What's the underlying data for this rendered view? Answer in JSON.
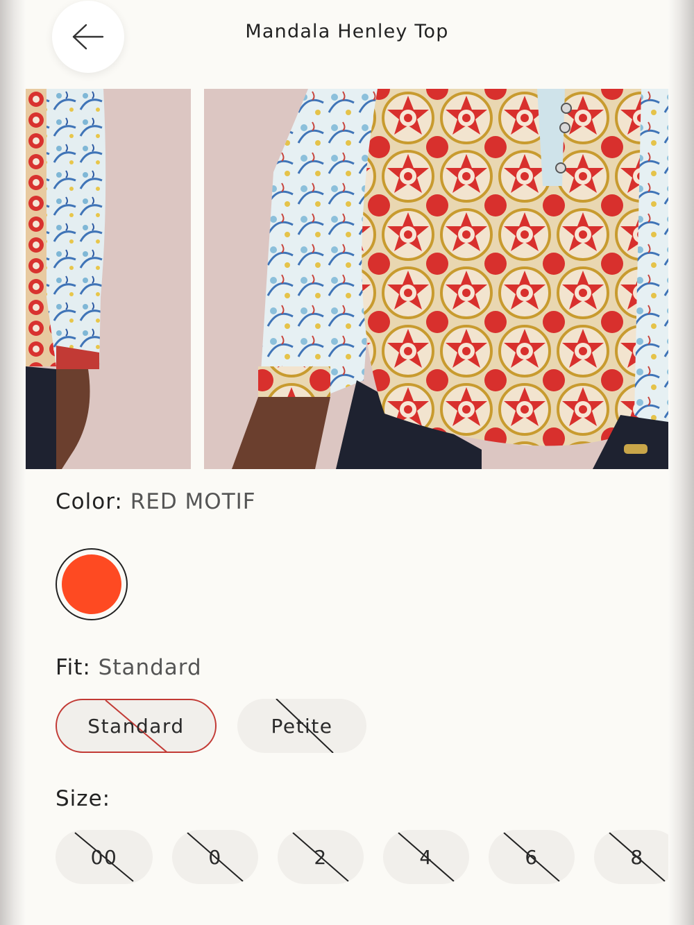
{
  "header": {
    "title": "Mandala Henley Top",
    "back_icon": "arrow-left-icon"
  },
  "color": {
    "label": "Color:",
    "value": "RED MOTIF",
    "swatch_hex": "#fe4a22"
  },
  "fit": {
    "label": "Fit:",
    "value": "Standard",
    "options": [
      {
        "label": "Standard",
        "selected": true,
        "unavailable": true
      },
      {
        "label": "Petite",
        "selected": false,
        "unavailable": true
      }
    ]
  },
  "size": {
    "label": "Size:",
    "options": [
      {
        "label": "00",
        "unavailable": true
      },
      {
        "label": "0",
        "unavailable": true
      },
      {
        "label": "2",
        "unavailable": true
      },
      {
        "label": "4",
        "unavailable": true
      },
      {
        "label": "6",
        "unavailable": true
      },
      {
        "label": "8",
        "unavailable": true
      }
    ]
  },
  "colors": {
    "accent_selected": "#c23a35",
    "pill_bg": "#f1efeb",
    "page_bg": "#fbfaf6"
  }
}
